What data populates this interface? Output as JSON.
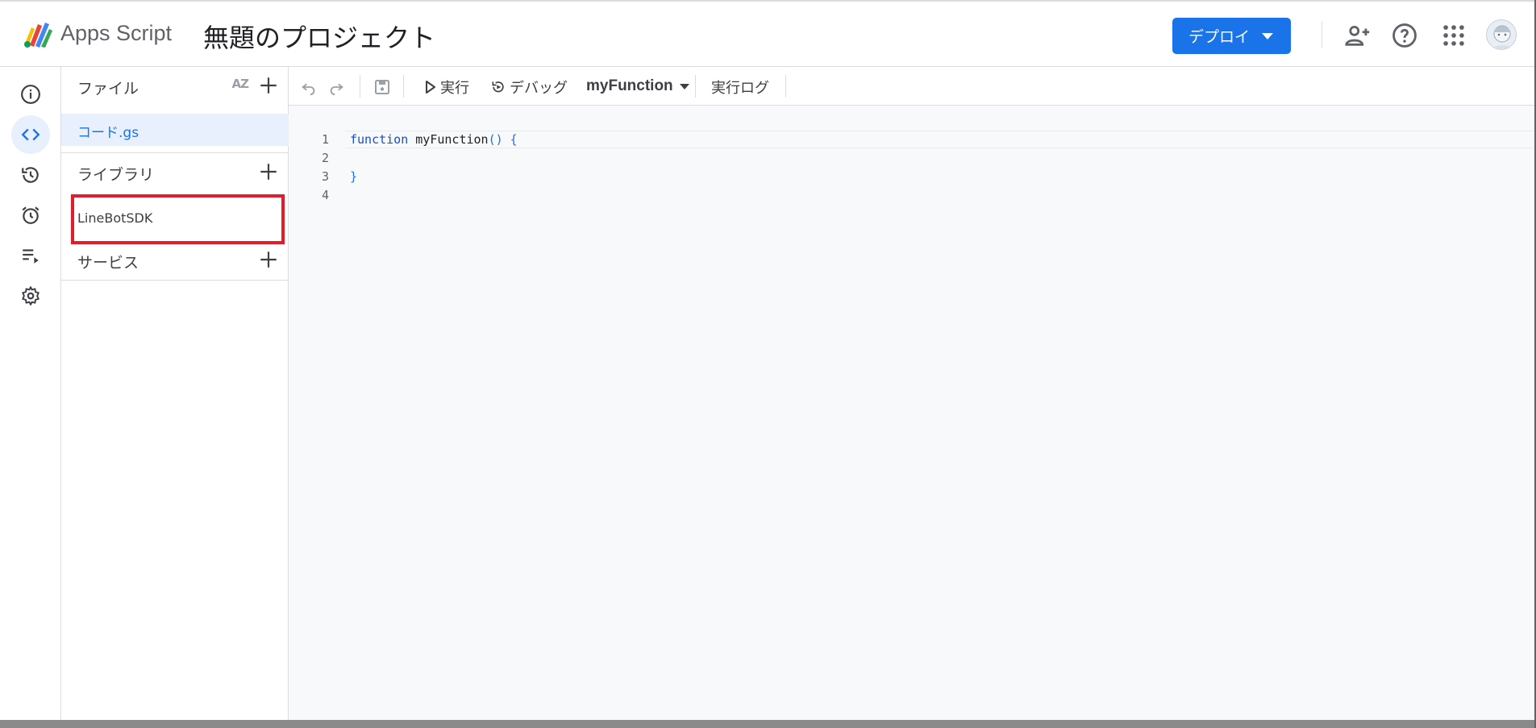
{
  "header": {
    "app_name": "Apps Script",
    "project_title": "無題のプロジェクト",
    "deploy_label": "デプロイ"
  },
  "files_panel": {
    "files_label": "ファイル",
    "sort_label": "AZ",
    "files": [
      {
        "name": "コード.gs"
      }
    ],
    "libraries_label": "ライブラリ",
    "libraries": [
      {
        "name": "LineBotSDK"
      }
    ],
    "services_label": "サービス"
  },
  "toolbar": {
    "run_label": "実行",
    "debug_label": "デバッグ",
    "function_select": "myFunction",
    "exec_log_label": "実行ログ"
  },
  "editor": {
    "line_numbers": [
      "1",
      "2",
      "3",
      "4"
    ],
    "code": {
      "keyword": "function",
      "fn_name": " myFunction",
      "parens": "()",
      "open_brace": " {",
      "close_brace": "}"
    }
  },
  "colors": {
    "accent": "#1a73e8",
    "highlight_box": "#e01d2a",
    "selected_file_bg": "#e8f0fe"
  },
  "icons": [
    "apps-script-logo",
    "add-person-icon",
    "help-icon",
    "apps-grid-icon",
    "info-icon",
    "code-icon",
    "history-icon",
    "alarm-icon",
    "executions-icon",
    "settings-icon",
    "undo-icon",
    "redo-icon",
    "save-icon",
    "play-icon",
    "debug-icon",
    "plus-icon"
  ]
}
